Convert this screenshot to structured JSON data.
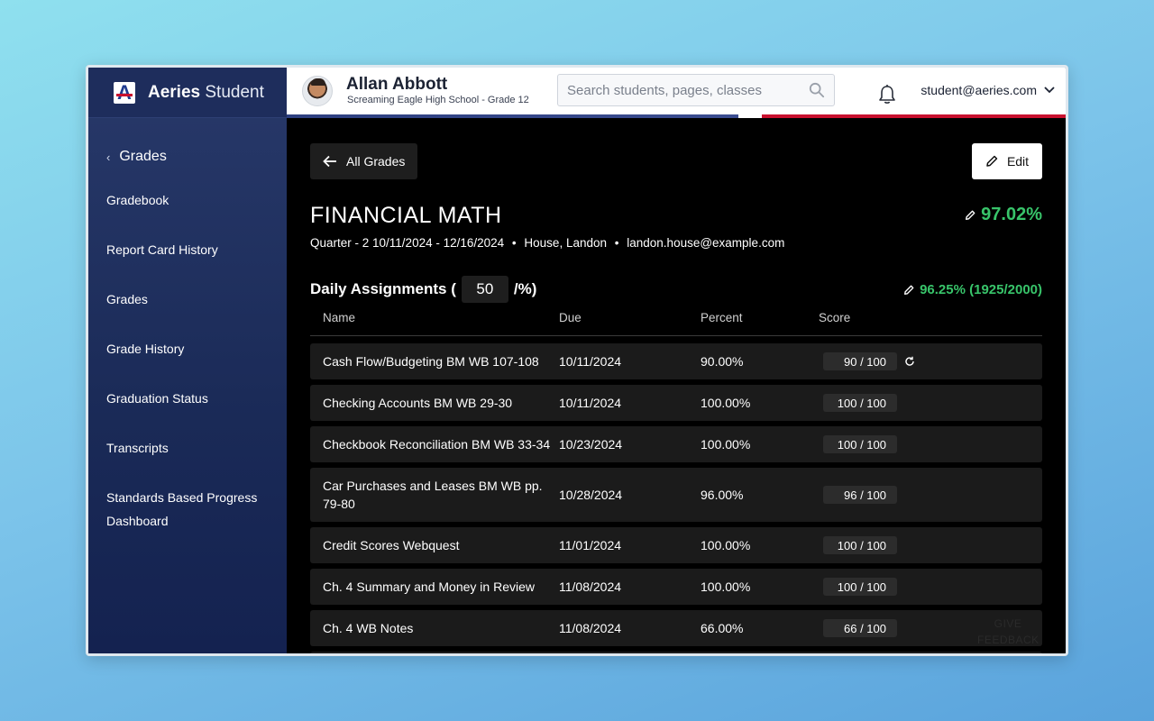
{
  "app": {
    "brand_bold": "Aeries",
    "brand_light": " Student",
    "logo_letter": "A"
  },
  "header": {
    "student_name": "Allan Abbott",
    "student_school": "Screaming Eagle High School - Grade 12",
    "search_placeholder": "Search students, pages, classes",
    "user_email": "student@aeries.com"
  },
  "sidebar": {
    "back_label": "Grades",
    "items": [
      {
        "label": "Gradebook"
      },
      {
        "label": "Report Card History"
      },
      {
        "label": "Grades"
      },
      {
        "label": "Grade History"
      },
      {
        "label": "Graduation Status"
      },
      {
        "label": "Transcripts"
      },
      {
        "label": "Standards Based Progress Dashboard"
      }
    ]
  },
  "main": {
    "all_grades_label": "All Grades",
    "edit_label": "Edit",
    "course_title": "FINANCIAL MATH",
    "course_grade": "97.02%",
    "term": "Quarter - 2 10/11/2024 - 12/16/2024",
    "teacher": "House, Landon",
    "teacher_email": "landon.house@example.com",
    "bullet": "•",
    "category": {
      "name_prefix": "Daily Assignments (",
      "weight": "50",
      "name_suffix": "/%)",
      "grade": "96.25% (1925/2000)"
    },
    "columns": {
      "name": "Name",
      "due": "Due",
      "percent": "Percent",
      "score": "Score"
    },
    "assignments": [
      {
        "name": "Cash Flow/Budgeting BM WB 107-108",
        "due": "10/11/2024",
        "percent": "90.00%",
        "score": "90 / 100"
      },
      {
        "name": "Checking Accounts BM WB 29-30",
        "due": "10/11/2024",
        "percent": "100.00%",
        "score": "100 / 100"
      },
      {
        "name": "Checkbook Reconciliation BM WB 33-34",
        "due": "10/23/2024",
        "percent": "100.00%",
        "score": "100 / 100"
      },
      {
        "name": "Car Purchases and Leases BM WB pp. 79-80",
        "due": "10/28/2024",
        "percent": "96.00%",
        "score": "96 / 100"
      },
      {
        "name": "Credit Scores Webquest",
        "due": "11/01/2024",
        "percent": "100.00%",
        "score": "100 / 100"
      },
      {
        "name": "Ch. 4 Summary and Money in Review",
        "due": "11/08/2024",
        "percent": "100.00%",
        "score": "100 / 100"
      },
      {
        "name": "Ch. 4 WB Notes",
        "due": "11/08/2024",
        "percent": "66.00%",
        "score": "66 / 100"
      }
    ],
    "feedback_label": "GIVE FEEDBACK"
  },
  "colors": {
    "accent_green": "#38c46a",
    "brand_navy": "#1e2d5c",
    "brand_red": "#c8102e"
  }
}
